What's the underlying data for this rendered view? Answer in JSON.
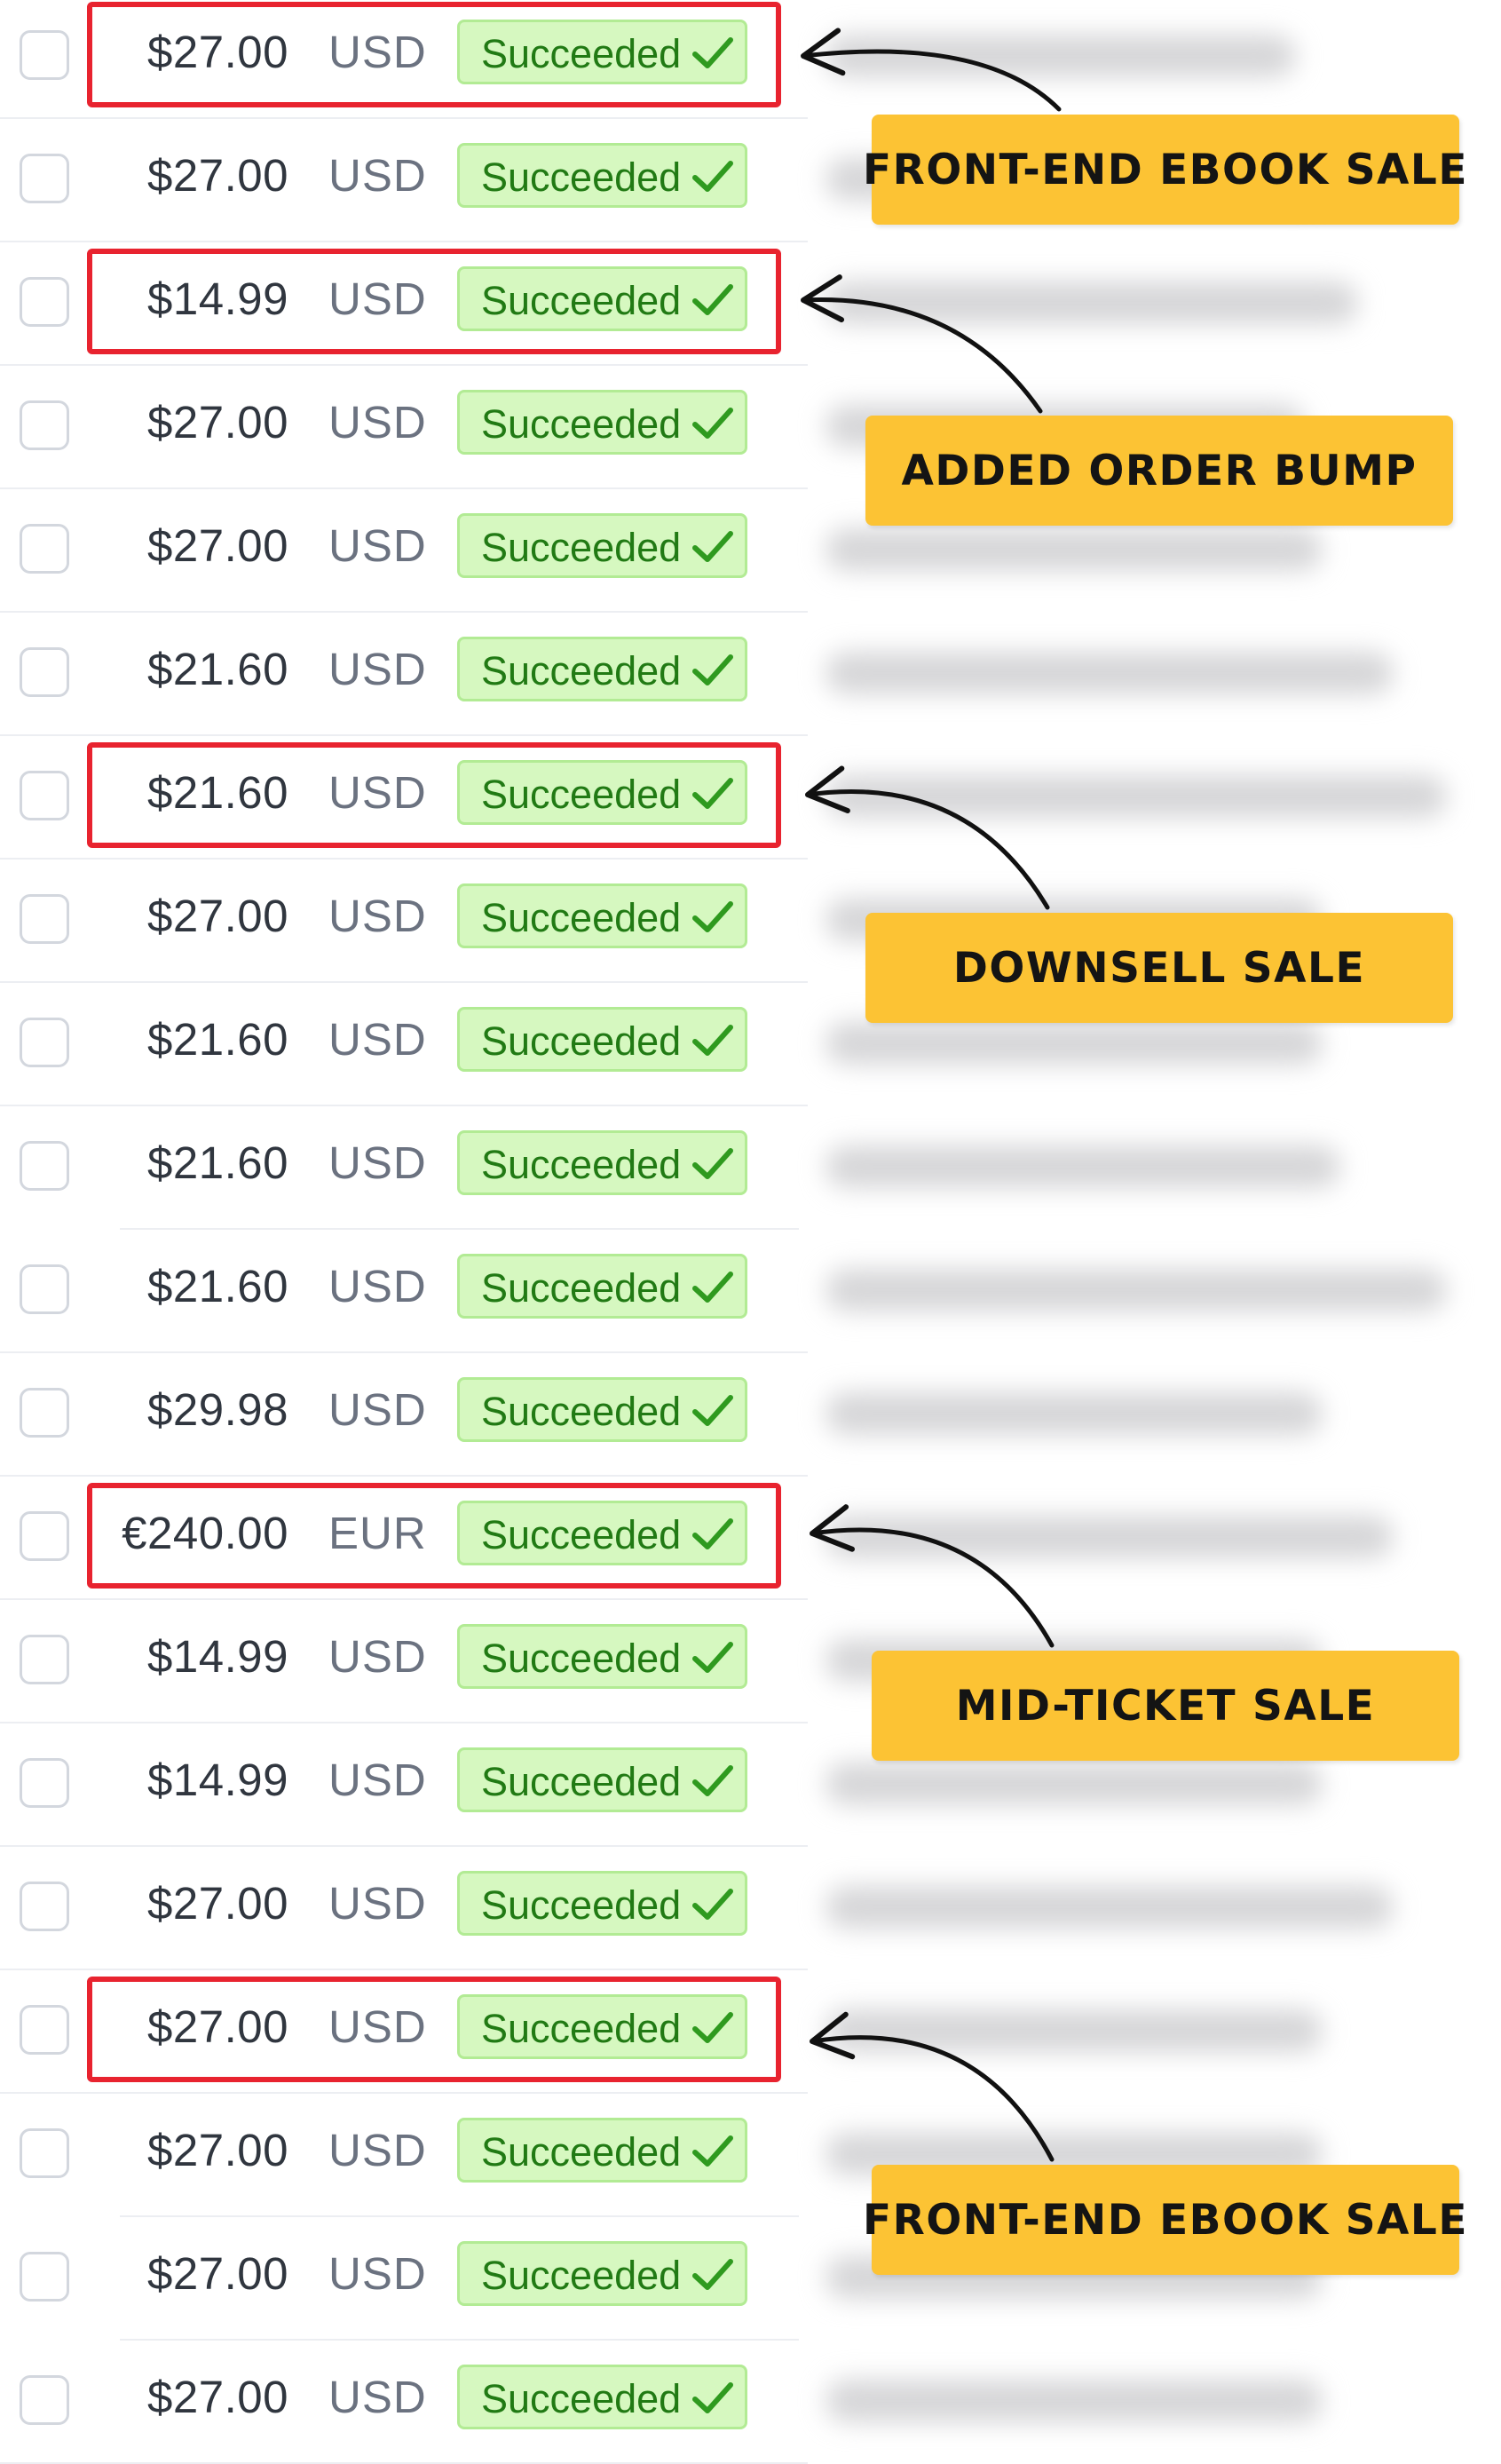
{
  "payments": [
    {
      "amount": "$27.00",
      "currency": "USD",
      "status": "Succeeded"
    },
    {
      "amount": "$27.00",
      "currency": "USD",
      "status": "Succeeded"
    },
    {
      "amount": "$14.99",
      "currency": "USD",
      "status": "Succeeded"
    },
    {
      "amount": "$27.00",
      "currency": "USD",
      "status": "Succeeded"
    },
    {
      "amount": "$27.00",
      "currency": "USD",
      "status": "Succeeded"
    },
    {
      "amount": "$21.60",
      "currency": "USD",
      "status": "Succeeded"
    },
    {
      "amount": "$21.60",
      "currency": "USD",
      "status": "Succeeded"
    },
    {
      "amount": "$27.00",
      "currency": "USD",
      "status": "Succeeded"
    },
    {
      "amount": "$21.60",
      "currency": "USD",
      "status": "Succeeded"
    },
    {
      "amount": "$21.60",
      "currency": "USD",
      "status": "Succeeded"
    },
    {
      "amount": "$21.60",
      "currency": "USD",
      "status": "Succeeded"
    },
    {
      "amount": "$29.98",
      "currency": "USD",
      "status": "Succeeded"
    },
    {
      "amount": "€240.00",
      "currency": "EUR",
      "status": "Succeeded"
    },
    {
      "amount": "$14.99",
      "currency": "USD",
      "status": "Succeeded"
    },
    {
      "amount": "$14.99",
      "currency": "USD",
      "status": "Succeeded"
    },
    {
      "amount": "$27.00",
      "currency": "USD",
      "status": "Succeeded"
    },
    {
      "amount": "$27.00",
      "currency": "USD",
      "status": "Succeeded"
    },
    {
      "amount": "$27.00",
      "currency": "USD",
      "status": "Succeeded"
    },
    {
      "amount": "$27.00",
      "currency": "USD",
      "status": "Succeeded"
    },
    {
      "amount": "$27.00",
      "currency": "USD",
      "status": "Succeeded"
    }
  ],
  "annotations": [
    {
      "label": "FRONT-END EBOOK SALE",
      "row": 1
    },
    {
      "label": "ADDED ORDER BUMP",
      "row": 3
    },
    {
      "label": "DOWNSELL SALE",
      "row": 7
    },
    {
      "label": "MID-TICKET SALE",
      "row": 13
    },
    {
      "label": "FRONT-END EBOOK SALE",
      "row": 17
    }
  ],
  "colors": {
    "highlight_border": "#e8232f",
    "callout_background": "#fcc334",
    "status_badge_background": "#d6f8c0",
    "status_badge_text": "#217a14"
  },
  "icons": {
    "status_icon": "checkmark-icon",
    "annotation_pointer": "curved-arrow-icon"
  }
}
